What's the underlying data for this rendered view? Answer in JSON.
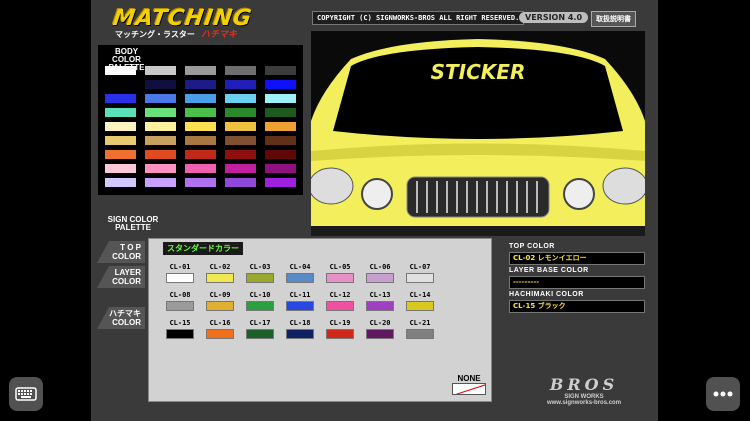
{
  "header": {
    "logo_main": "MATCHING",
    "logo_sub": "マッチング・ラスター",
    "logo_tag": "ハチマキ",
    "copyright": "COPYRIGHT (C) SIGNWORKS-BROS ALL RIGHT RESERVED.",
    "version": "VERSION 4.0",
    "manual_button": "取扱説明書"
  },
  "body_palette": {
    "title": "BODY COLOR PALETTE",
    "colors": [
      "#ffffff",
      "#c8c8c8",
      "#9a9a9a",
      "#6e6e6e",
      "#3c3c3c",
      "#000000",
      "#101040",
      "#1c1c88",
      "#2020b8",
      "#1010ff",
      "#2830e8",
      "#4a78e8",
      "#4aa0e8",
      "#6ad0f0",
      "#9ef0f8",
      "#5ae0b8",
      "#6ae07a",
      "#4ac04a",
      "#2a8a2a",
      "#1e5a1e",
      "#fff4c0",
      "#fff0a0",
      "#ffe050",
      "#f0c040",
      "#f0a030",
      "#e8c870",
      "#c8a060",
      "#a87840",
      "#805030",
      "#603018",
      "#f07030",
      "#e04a20",
      "#c02818",
      "#901010",
      "#600808",
      "#ffc8d8",
      "#ff90c0",
      "#f060b0",
      "#c020a0",
      "#901080",
      "#d0c8ff",
      "#c8a0ff",
      "#b070f0",
      "#9048d8",
      "#a020e0"
    ]
  },
  "preview": {
    "sticker_text": "STICKER",
    "car_color": "#f2ee5c",
    "visor_color": "#000000",
    "sticker_color": "#f2ee5c"
  },
  "sign_palette": {
    "title": "SIGN COLOR PALETTE",
    "buttons": [
      {
        "line1": "T O P",
        "line2": "COLOR"
      },
      {
        "line1": "LAYER",
        "line2": "COLOR"
      },
      {
        "line1": "ハチマキ",
        "line2": "COLOR"
      }
    ]
  },
  "popup": {
    "heading": "スタンダードカラー",
    "colors": [
      {
        "code": "CL-01",
        "hex": "#ffffff"
      },
      {
        "code": "CL-02",
        "hex": "#f0e850"
      },
      {
        "code": "CL-03",
        "hex": "#9aa832"
      },
      {
        "code": "CL-04",
        "hex": "#5a8ac8"
      },
      {
        "code": "CL-05",
        "hex": "#e890c8"
      },
      {
        "code": "CL-06",
        "hex": "#c8a0d0"
      },
      {
        "code": "CL-07",
        "hex": "#e0e0e0"
      },
      {
        "code": "CL-08",
        "hex": "#9a9a9a"
      },
      {
        "code": "CL-09",
        "hex": "#e0b030"
      },
      {
        "code": "CL-10",
        "hex": "#28a040"
      },
      {
        "code": "CL-11",
        "hex": "#2848e0"
      },
      {
        "code": "CL-12",
        "hex": "#f050a0"
      },
      {
        "code": "CL-13",
        "hex": "#a040c0"
      },
      {
        "code": "CL-14",
        "hex": "#d8c820"
      },
      {
        "code": "CL-15",
        "hex": "#000000"
      },
      {
        "code": "CL-16",
        "hex": "#f07020"
      },
      {
        "code": "CL-17",
        "hex": "#1a6028"
      },
      {
        "code": "CL-18",
        "hex": "#102060"
      },
      {
        "code": "CL-19",
        "hex": "#d02818"
      },
      {
        "code": "CL-20",
        "hex": "#601860"
      },
      {
        "code": "CL-21",
        "hex": "#808080"
      }
    ],
    "none_label": "NONE"
  },
  "info": {
    "top_label": "TOP COLOR",
    "top_value": "CL-02 レモンイエロー",
    "layer_label": "LAYER BASE COLOR",
    "layer_value": "---------",
    "hachimaki_label": "HACHIMAKI COLOR",
    "hachimaki_value": "CL-15 ブラック"
  },
  "brand": {
    "logo": "BROS",
    "sub": "SIGN WORKS",
    "url": "www.signworks-bros.com"
  },
  "overlay": {
    "keyboard_icon": "keyboard-icon",
    "more_icon": "more-dots-icon"
  }
}
